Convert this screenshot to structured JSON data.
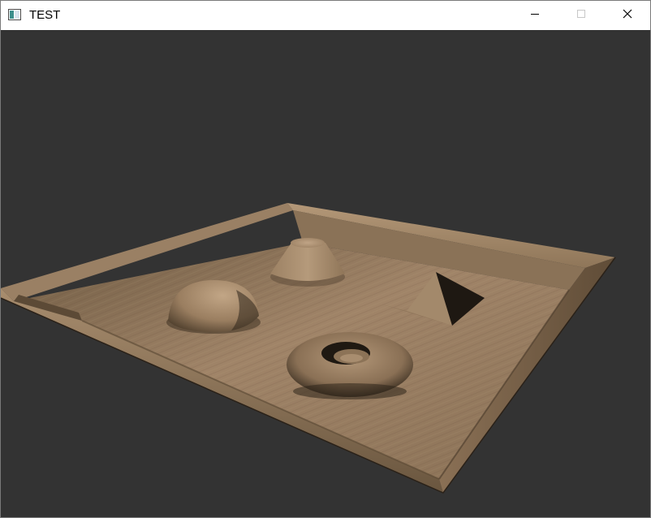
{
  "window": {
    "title": "TEST",
    "icon": "app-window-icon",
    "controls": {
      "minimize": "minimize-icon",
      "maximize": "maximize-icon",
      "close": "close-icon"
    }
  },
  "scene": {
    "background_color": "#333333",
    "material": "wood",
    "objects": [
      "truncated-cone",
      "hemisphere",
      "pyramid",
      "torus"
    ]
  }
}
